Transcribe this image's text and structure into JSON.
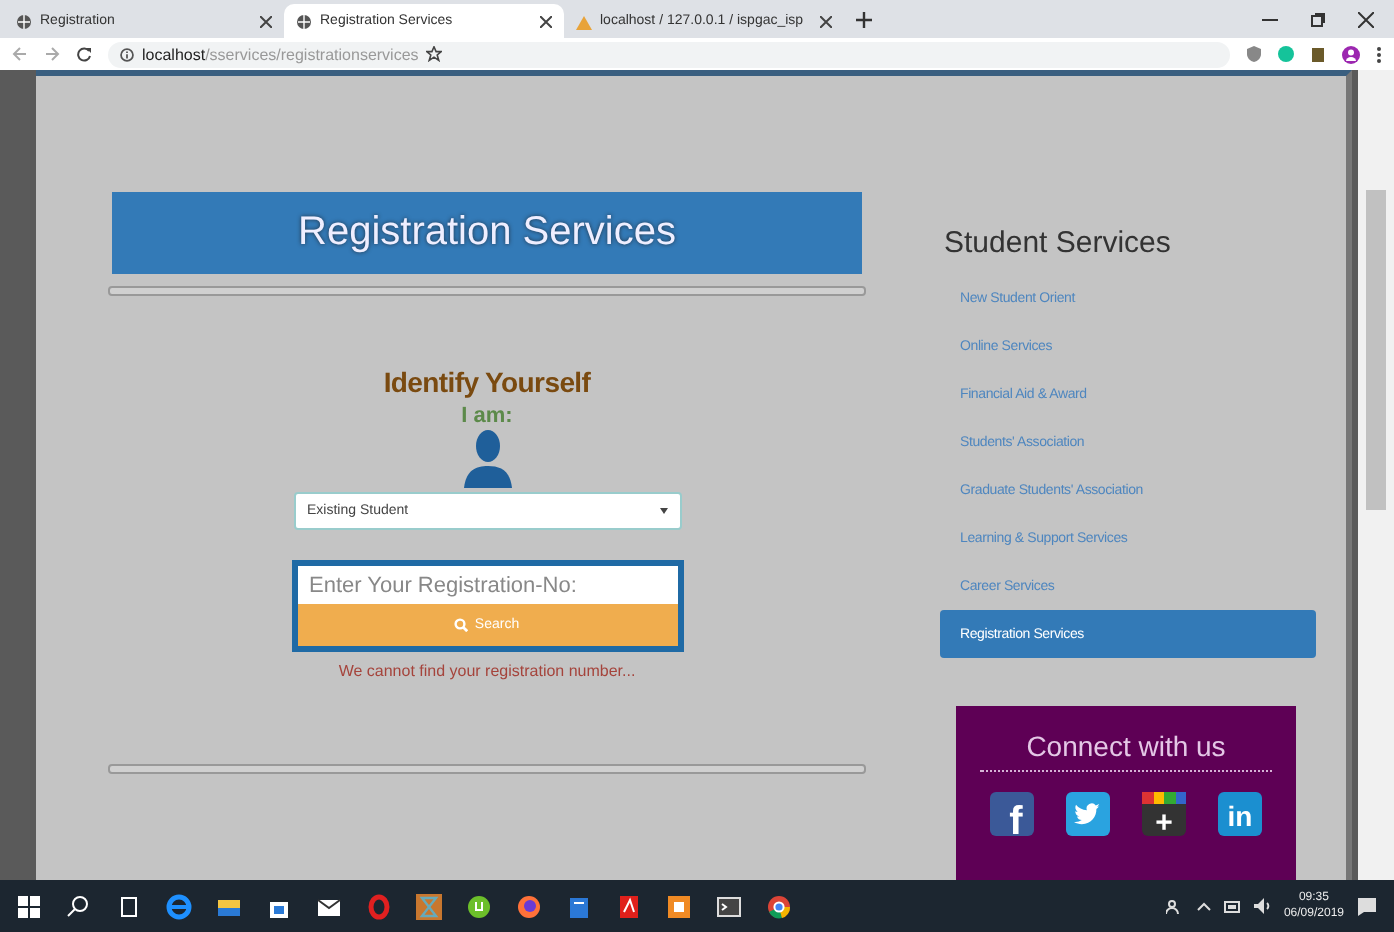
{
  "browser": {
    "tabs": [
      {
        "title": "Registration",
        "kind": "globe",
        "selected": false
      },
      {
        "title": "Registration Services",
        "kind": "globe",
        "selected": true
      },
      {
        "title": "localhost / 127.0.0.1 / ispgac_isp",
        "kind": "db",
        "selected": false
      }
    ],
    "url_host": "localhost",
    "url_path": "/sservices/registrationservices"
  },
  "main": {
    "title": "Registration Services",
    "heading": "Identify Yourself",
    "prompt": "I am:",
    "select_value": "Existing Student",
    "placeholder": "Enter Your Registration-No:",
    "button": "Search",
    "error": "We cannot find your registration number..."
  },
  "sidebar": {
    "title": "Student Services",
    "items": [
      {
        "label": "New Student Orient",
        "selected": false
      },
      {
        "label": "Online Services",
        "selected": false
      },
      {
        "label": "Financial Aid & Award",
        "selected": false
      },
      {
        "label": "Students' Association",
        "selected": false
      },
      {
        "label": "Graduate Students' Association",
        "selected": false
      },
      {
        "label": "Learning & Support Services",
        "selected": false
      },
      {
        "label": "Career Services",
        "selected": false
      },
      {
        "label": "Registration Services",
        "selected": true
      }
    ]
  },
  "connect": {
    "title": "Connect with us",
    "social": [
      {
        "kind": "facebook",
        "label": "f"
      },
      {
        "kind": "twitter"
      },
      {
        "kind": "googleplus",
        "label": "+"
      },
      {
        "kind": "linkedin",
        "label": "in"
      }
    ]
  },
  "taskbar": {
    "time": "09:35",
    "date": "06/09/2019"
  }
}
